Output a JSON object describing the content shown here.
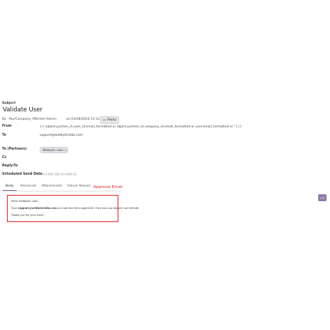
{
  "header": {
    "subject_label": "Subject",
    "title": "Validate User",
    "by_label": "By",
    "author": "YourCompany, Mitchell Admin",
    "date": "on 03/28/2024 15:12:00",
    "reply_label": "Reply"
  },
  "fields": {
    "from_label": "From",
    "from_value": "{{ (object.partner_id.user_id.email_formatted or                object.partner_id.company_id.email_formatted or user.email_formatted or '') }}",
    "to_label": "To",
    "to_value": "support@webkyticlabs.com",
    "to_partners_label": "To (Partners)",
    "to_partners_tag": "Webkytic Labs",
    "cc_label": "Cc",
    "reply_to_label": "Reply-To",
    "scheduled_label": "Scheduled Send Date",
    "scheduled_placeholder": "YYYY-MM-DD HH:MM:SS"
  },
  "tabs": [
    {
      "label": "Body",
      "active": true
    },
    {
      "label": "Advanced",
      "active": false
    },
    {
      "label": "Attachments",
      "active": false
    },
    {
      "label": "Failure Reason",
      "active": false
    }
  ],
  "annotation": "Approval Email",
  "email": {
    "greeting": "Hello Webkytic Labs,",
    "body_prefix": "Your",
    "body_email": "support@webkyticlabs.com",
    "body_suffix": "account has been approved, Now you can explore our website",
    "closing": "Thank you for your trust!"
  },
  "toolbar": {
    "code_label": "</>"
  },
  "colors": {
    "accent": "#7c5f8b",
    "annotation": "#e11d22"
  }
}
